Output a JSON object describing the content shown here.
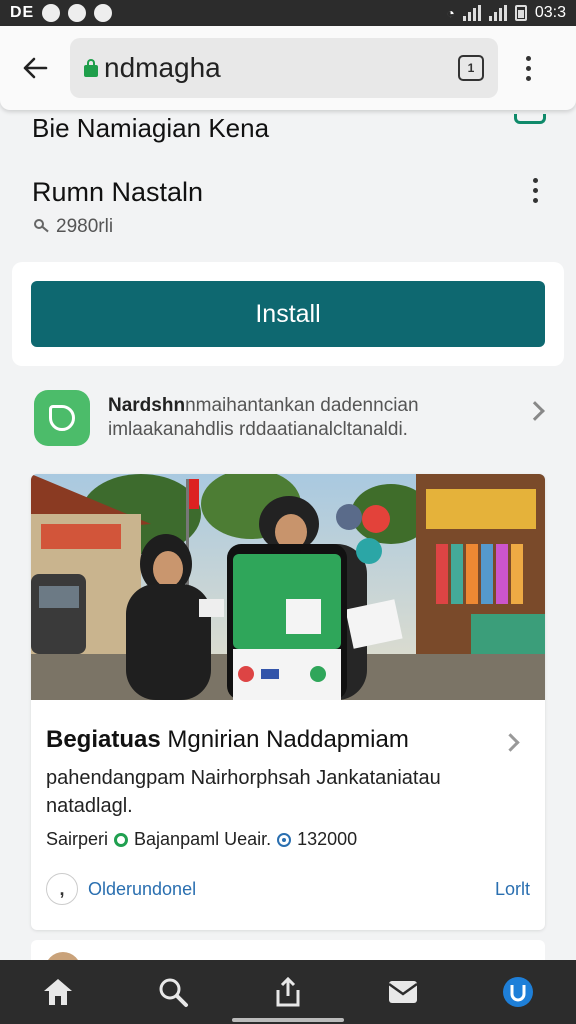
{
  "status_bar": {
    "left_text": "DE",
    "time": "03:3"
  },
  "browser": {
    "url": "ndmagha",
    "tabs_count": "1"
  },
  "app": {
    "title": "Bie Namiagian Kena",
    "developer": "Rumn Nastaln",
    "downloads": "2980rli",
    "install_label": "Install"
  },
  "promo": {
    "bold": "Nardshn",
    "line1_rest": "nmaihantankan dadenncian",
    "line2": "imlaakanahdlis rddaatianalcltanaldi."
  },
  "article": {
    "title_bold": "Begiatuas",
    "title_rest": " Mgnirian Naddapmiam",
    "description": "pahendangpam Nairhorphsah Jankataniatau natadlagl.",
    "meta_author": "Sairperi",
    "meta_source": "Bajanpaml Ueair.",
    "meta_count": "132000",
    "comment_label": "Olderundonel",
    "action_label": "Lorlt"
  },
  "bottom_nav": [
    "home-icon",
    "search-icon",
    "share-icon",
    "mail-icon",
    "profile-icon"
  ],
  "colors": {
    "install": "#0e6870",
    "accent_green": "#4cbc6a",
    "link": "#2a6fb0"
  }
}
